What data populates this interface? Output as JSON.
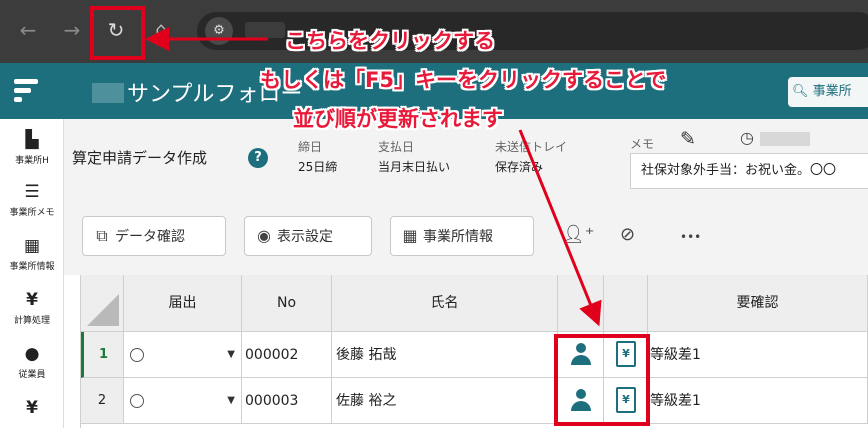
{
  "browser": {
    "back_icon": "arrow-left-icon",
    "forward_icon": "arrow-right-icon",
    "reload_icon": "reload-icon",
    "home_icon": "home-icon"
  },
  "app": {
    "title": "サンプルフォロー",
    "search_placeholder": "事業所"
  },
  "sidebar": {
    "items": [
      {
        "label": "事業所H",
        "icon": "office-home-icon"
      },
      {
        "label": "事業所メモ",
        "icon": "memo-list-icon"
      },
      {
        "label": "事業所情報",
        "icon": "building-icon"
      },
      {
        "label": "計算処理",
        "icon": "calc-file-icon"
      },
      {
        "label": "従業員",
        "icon": "person-icon"
      }
    ]
  },
  "info": {
    "page_title": "算定申請データ作成",
    "closing_label": "締日",
    "closing_value": "25日締",
    "payday_label": "支払日",
    "payday_value": "当月末日払い",
    "outbox_label": "未送信トレイ",
    "outbox_value": "保存済み",
    "memo_label": "メモ",
    "memo_text": "社保対象外手当：お祝い金。〇〇"
  },
  "toolbar": {
    "data_check": "データ確認",
    "display_settings": "表示設定",
    "office_info": "事業所情報",
    "more": "•••"
  },
  "table": {
    "headers": {
      "notify": "届出",
      "no": "No",
      "name": "氏名",
      "check": "要確認"
    },
    "rows": [
      {
        "num": "1",
        "no": "000002",
        "name": "後藤 拓哉",
        "check": "等級差1"
      },
      {
        "num": "2",
        "no": "000003",
        "name": "佐藤 裕之",
        "check": "等級差1"
      }
    ]
  },
  "annotation": {
    "line1": "こちらをクリックする",
    "line2": "もしくは「F5」キーをクリックすることで",
    "line3": "並び順が更新されます"
  },
  "colors": {
    "brand": "#1e6f7e",
    "highlight": "#e0001b",
    "annotation_text": "#e81a3a"
  }
}
